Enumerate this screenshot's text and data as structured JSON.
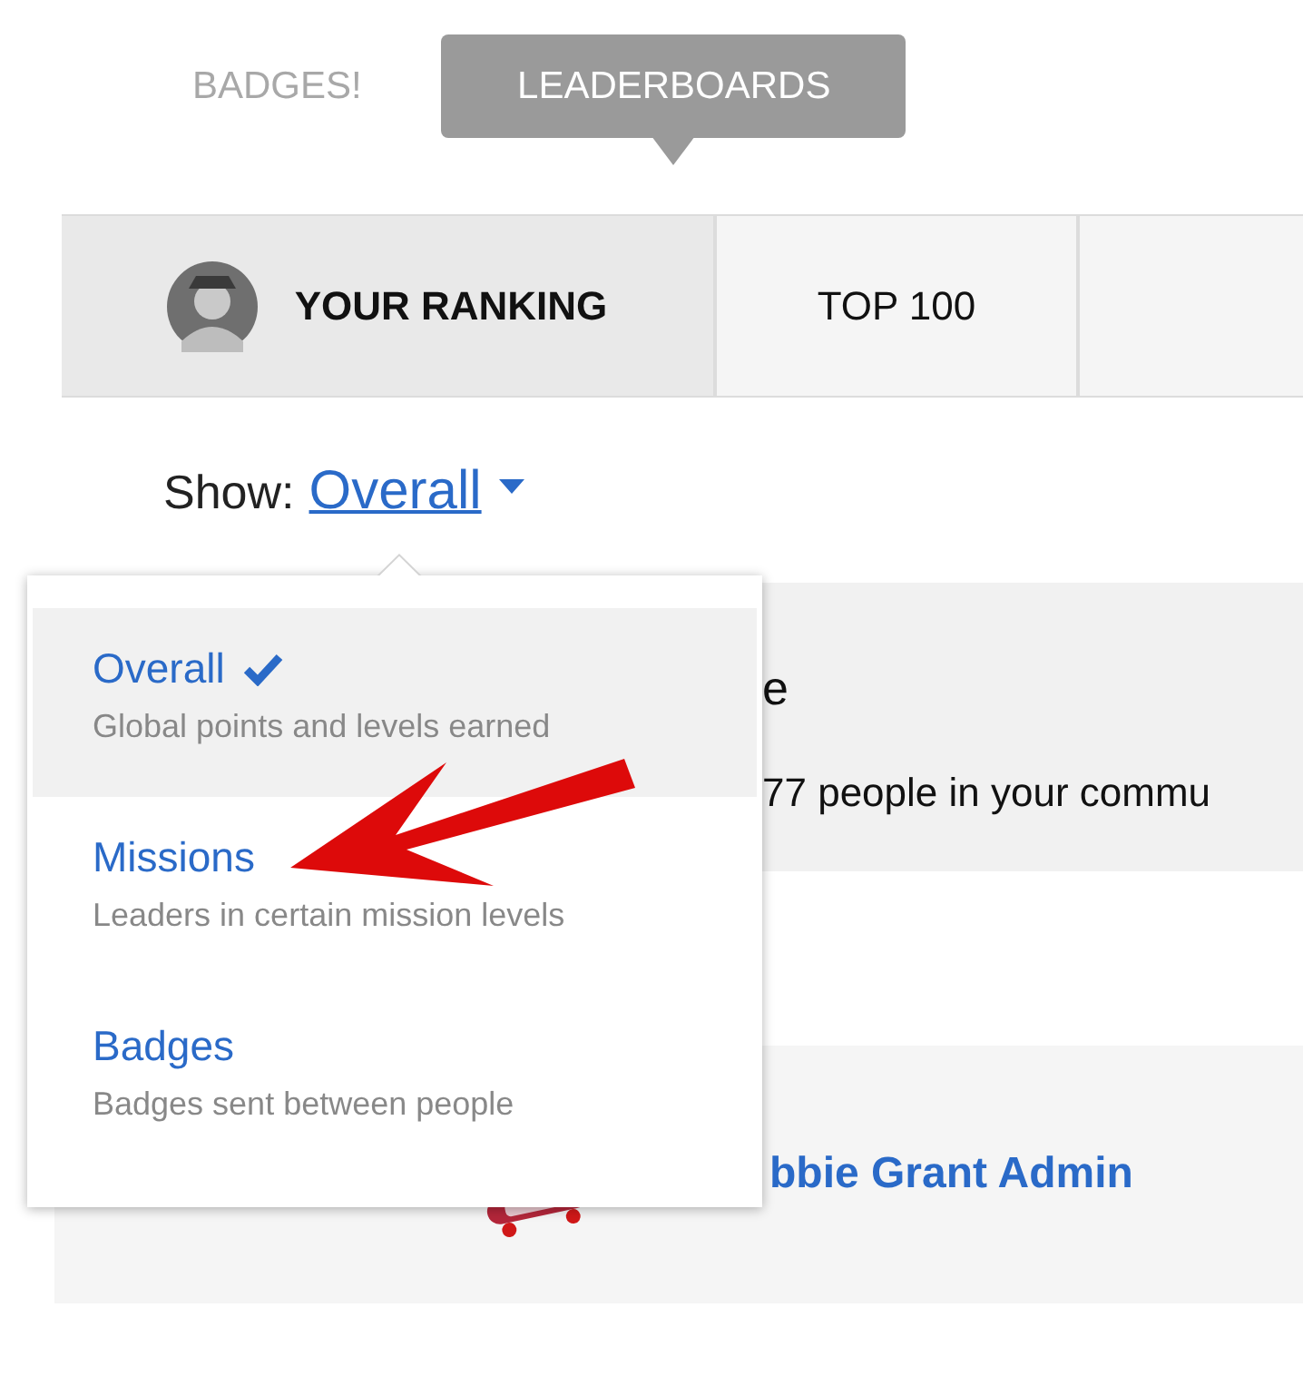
{
  "nav_tabs": [
    {
      "label": "BADGES!",
      "selected": false
    },
    {
      "label": "LEADERBOARDS",
      "selected": true
    }
  ],
  "ranking_tabs": [
    {
      "label": "YOUR RANKING",
      "selected": true,
      "avatar": true
    },
    {
      "label": "TOP 100",
      "selected": false,
      "avatar": false
    },
    {
      "selected": false,
      "avatar": false
    }
  ],
  "show": {
    "label": "Show:",
    "value": "Overall"
  },
  "summary_panel": {
    "line_1": "e",
    "line_2": "77 people in your commu"
  },
  "leader_row": {
    "name": "bbie Grant Admin"
  },
  "dropdown": {
    "items": [
      {
        "title": "Overall",
        "description": "Global points and levels earned",
        "selected": true
      },
      {
        "title": "Missions",
        "description": "Leaders in certain mission levels",
        "selected": false
      },
      {
        "title": "Badges",
        "description": "Badges sent between people",
        "selected": false
      }
    ]
  }
}
